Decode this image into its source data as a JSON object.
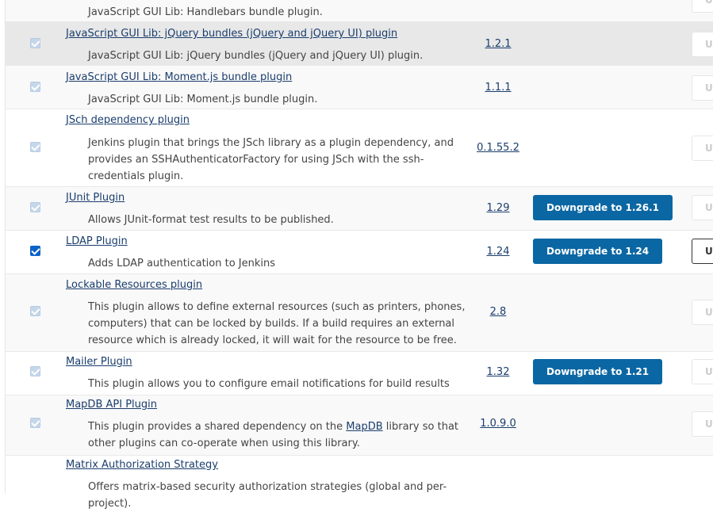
{
  "uninstall_label": "Uninstall",
  "plugins": [
    {
      "name": "",
      "description": "JavaScript GUI Lib: Handlebars bundle plugin.",
      "version": "",
      "downgrade": "",
      "checked": false
    },
    {
      "name": "JavaScript GUI Lib: jQuery bundles (jQuery and jQuery UI) plugin",
      "description": "JavaScript GUI Lib: jQuery bundles (jQuery and jQuery UI) plugin.",
      "version": "1.2.1",
      "downgrade": "",
      "checked": false
    },
    {
      "name": "JavaScript GUI Lib: Moment.js bundle plugin",
      "description": "JavaScript GUI Lib: Moment.js bundle plugin.",
      "version": "1.1.1",
      "downgrade": "",
      "checked": false
    },
    {
      "name": "JSch dependency plugin",
      "description": "Jenkins plugin that brings the JSch library as a plugin dependency, and provides an SSHAuthenticatorFactory for using JSch with the ssh-credentials plugin.",
      "version": "0.1.55.2",
      "downgrade": "",
      "checked": false
    },
    {
      "name": "JUnit Plugin",
      "description": "Allows JUnit-format test results to be published.",
      "version": "1.29",
      "downgrade": "Downgrade to 1.26.1",
      "checked": false
    },
    {
      "name": "LDAP Plugin",
      "description": "Adds LDAP authentication to Jenkins",
      "version": "1.24",
      "downgrade": "Downgrade to 1.24",
      "checked": true
    },
    {
      "name": "Lockable Resources plugin",
      "description": "This plugin allows to define external resources (such as printers, phones, computers) that can be locked by builds. If a build requires an external resource which is already locked, it will wait for the resource to be free.",
      "version": "2.8",
      "downgrade": "",
      "checked": false
    },
    {
      "name": "Mailer Plugin",
      "description": "This plugin allows you to configure email notifications for build results",
      "version": "1.32",
      "downgrade": "Downgrade to 1.21",
      "checked": false
    },
    {
      "name": "MapDB API Plugin",
      "description_before": "This plugin provides a shared dependency on the ",
      "description_link": "MapDB",
      "description_after": " library so that other plugins can co-operate when using this library.",
      "version": "1.0.9.0",
      "downgrade": "",
      "checked": false
    },
    {
      "name": "Matrix Authorization Strategy",
      "description": "Offers matrix-based security authorization strategies (global and per-project).",
      "version": "",
      "downgrade": "",
      "checked": false
    }
  ]
}
